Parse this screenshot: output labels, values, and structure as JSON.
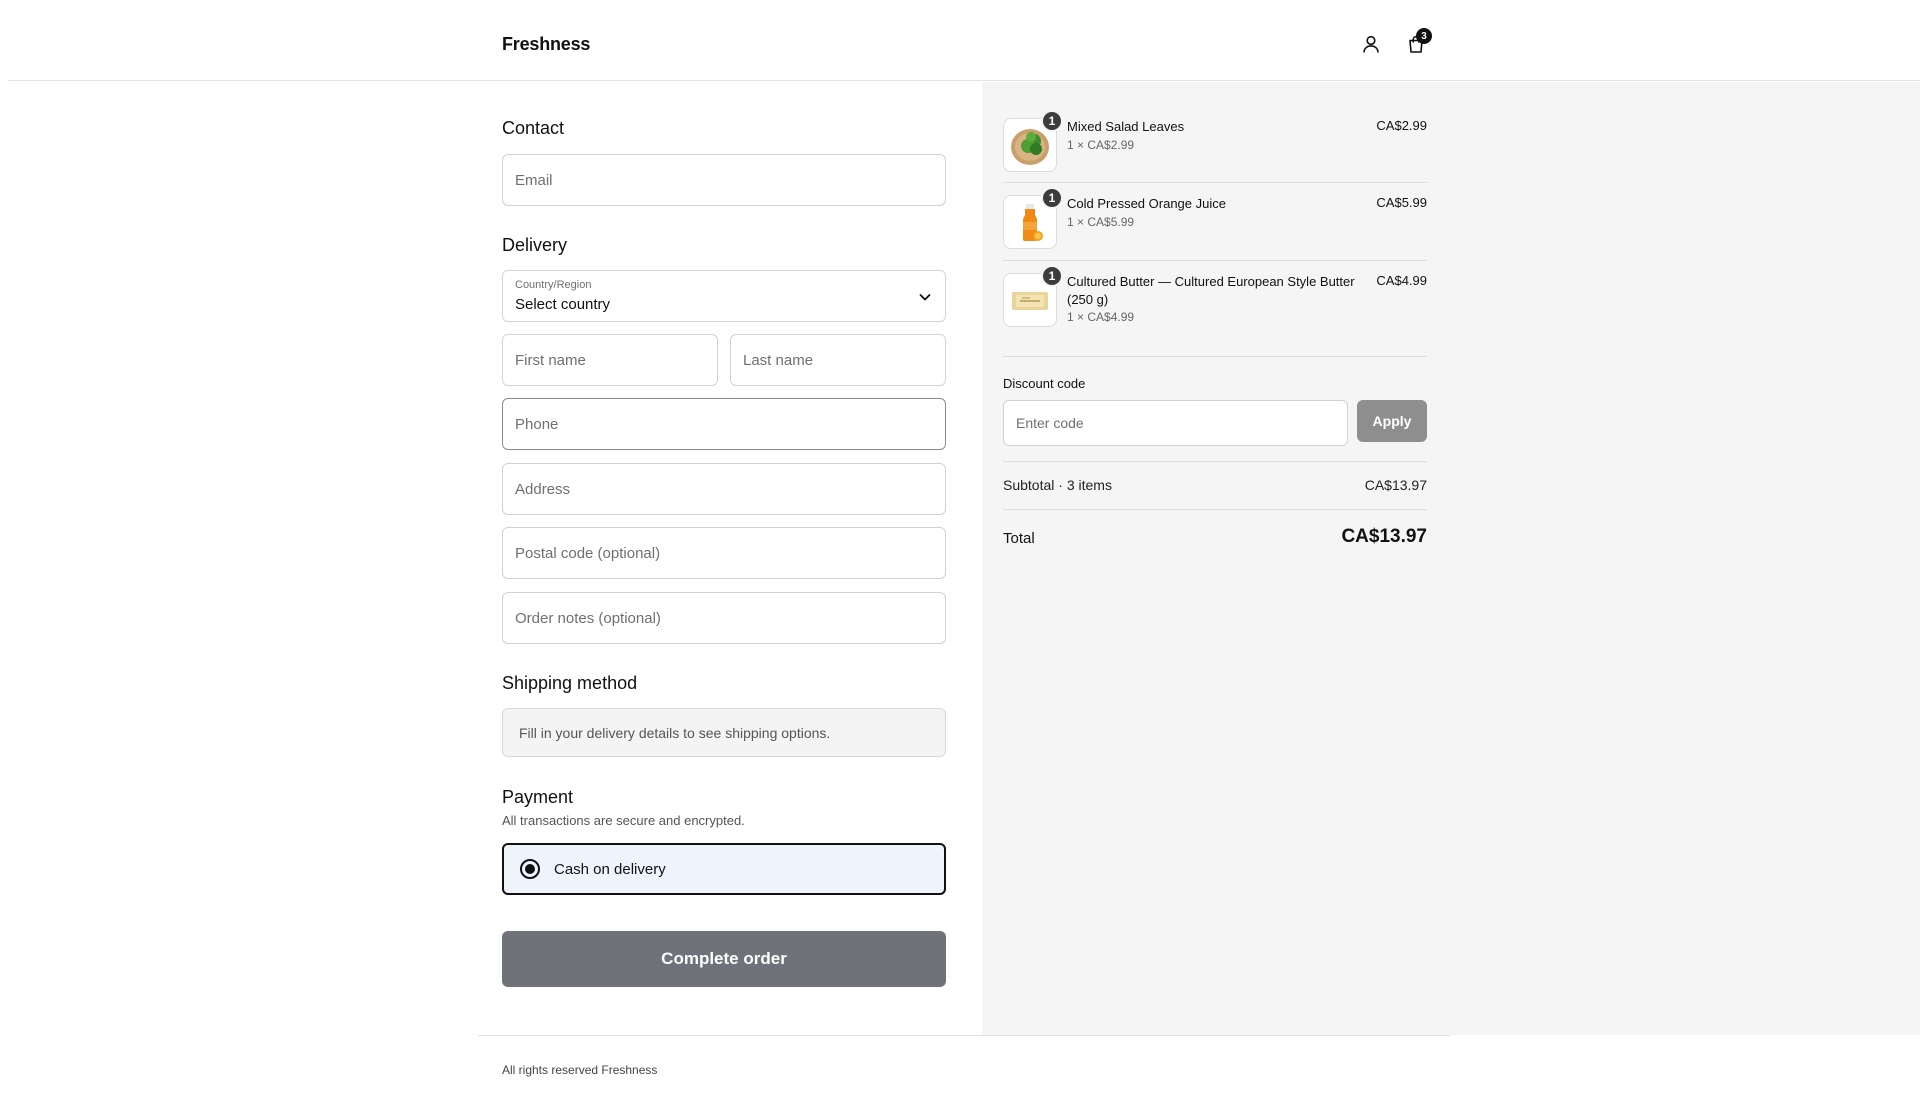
{
  "header": {
    "logo": "Freshness",
    "cart_count": "3",
    "icons": {
      "account": "user-icon",
      "cart": "shopping-bag-icon"
    }
  },
  "contact": {
    "title": "Contact",
    "email_placeholder": "Email"
  },
  "delivery": {
    "title": "Delivery",
    "country_label": "Country/Region",
    "country_value": "Select country",
    "first_name_placeholder": "First name",
    "last_name_placeholder": "Last name",
    "phone_placeholder": "Phone",
    "address_placeholder": "Address",
    "postal_placeholder": "Postal code (optional)",
    "notes_placeholder": "Order notes (optional)"
  },
  "shipping": {
    "title": "Shipping method",
    "message": "Fill in your delivery details to see shipping options."
  },
  "payment": {
    "title": "Payment",
    "subtitle": "All transactions are secure and encrypted.",
    "option_label": "Cash on delivery",
    "selected": true
  },
  "complete_button": "Complete order",
  "footer": {
    "text": "All rights reserved Freshness"
  },
  "summary": {
    "items": [
      {
        "name": "Mixed Salad Leaves",
        "qty": "1",
        "meta": "1 × CA$2.99",
        "price": "CA$2.99",
        "thumb": "salad-image"
      },
      {
        "name": "Cold Pressed Orange Juice",
        "qty": "1",
        "meta": "1 × CA$5.99",
        "price": "CA$5.99",
        "thumb": "juice-bottle-image"
      },
      {
        "name": "Cultured Butter — Cultured European Style Butter (250 g)",
        "qty": "1",
        "meta": "1 × CA$4.99",
        "price": "CA$4.99",
        "thumb": "butter-image"
      }
    ],
    "discount_title": "Discount code",
    "discount_placeholder": "Enter code",
    "apply_label": "Apply",
    "subtotal_label": "Subtotal · 3 items",
    "subtotal_value": "CA$13.97",
    "total_label": "Total",
    "total_value": "CA$13.97"
  },
  "colors": {
    "accent": "#111111",
    "summary_bg": "#f5f5f5",
    "complete_button_bg": "#6f7279",
    "apply_button_bg": "#8e8e8e",
    "payment_selected_bg": "#eef3fc"
  }
}
